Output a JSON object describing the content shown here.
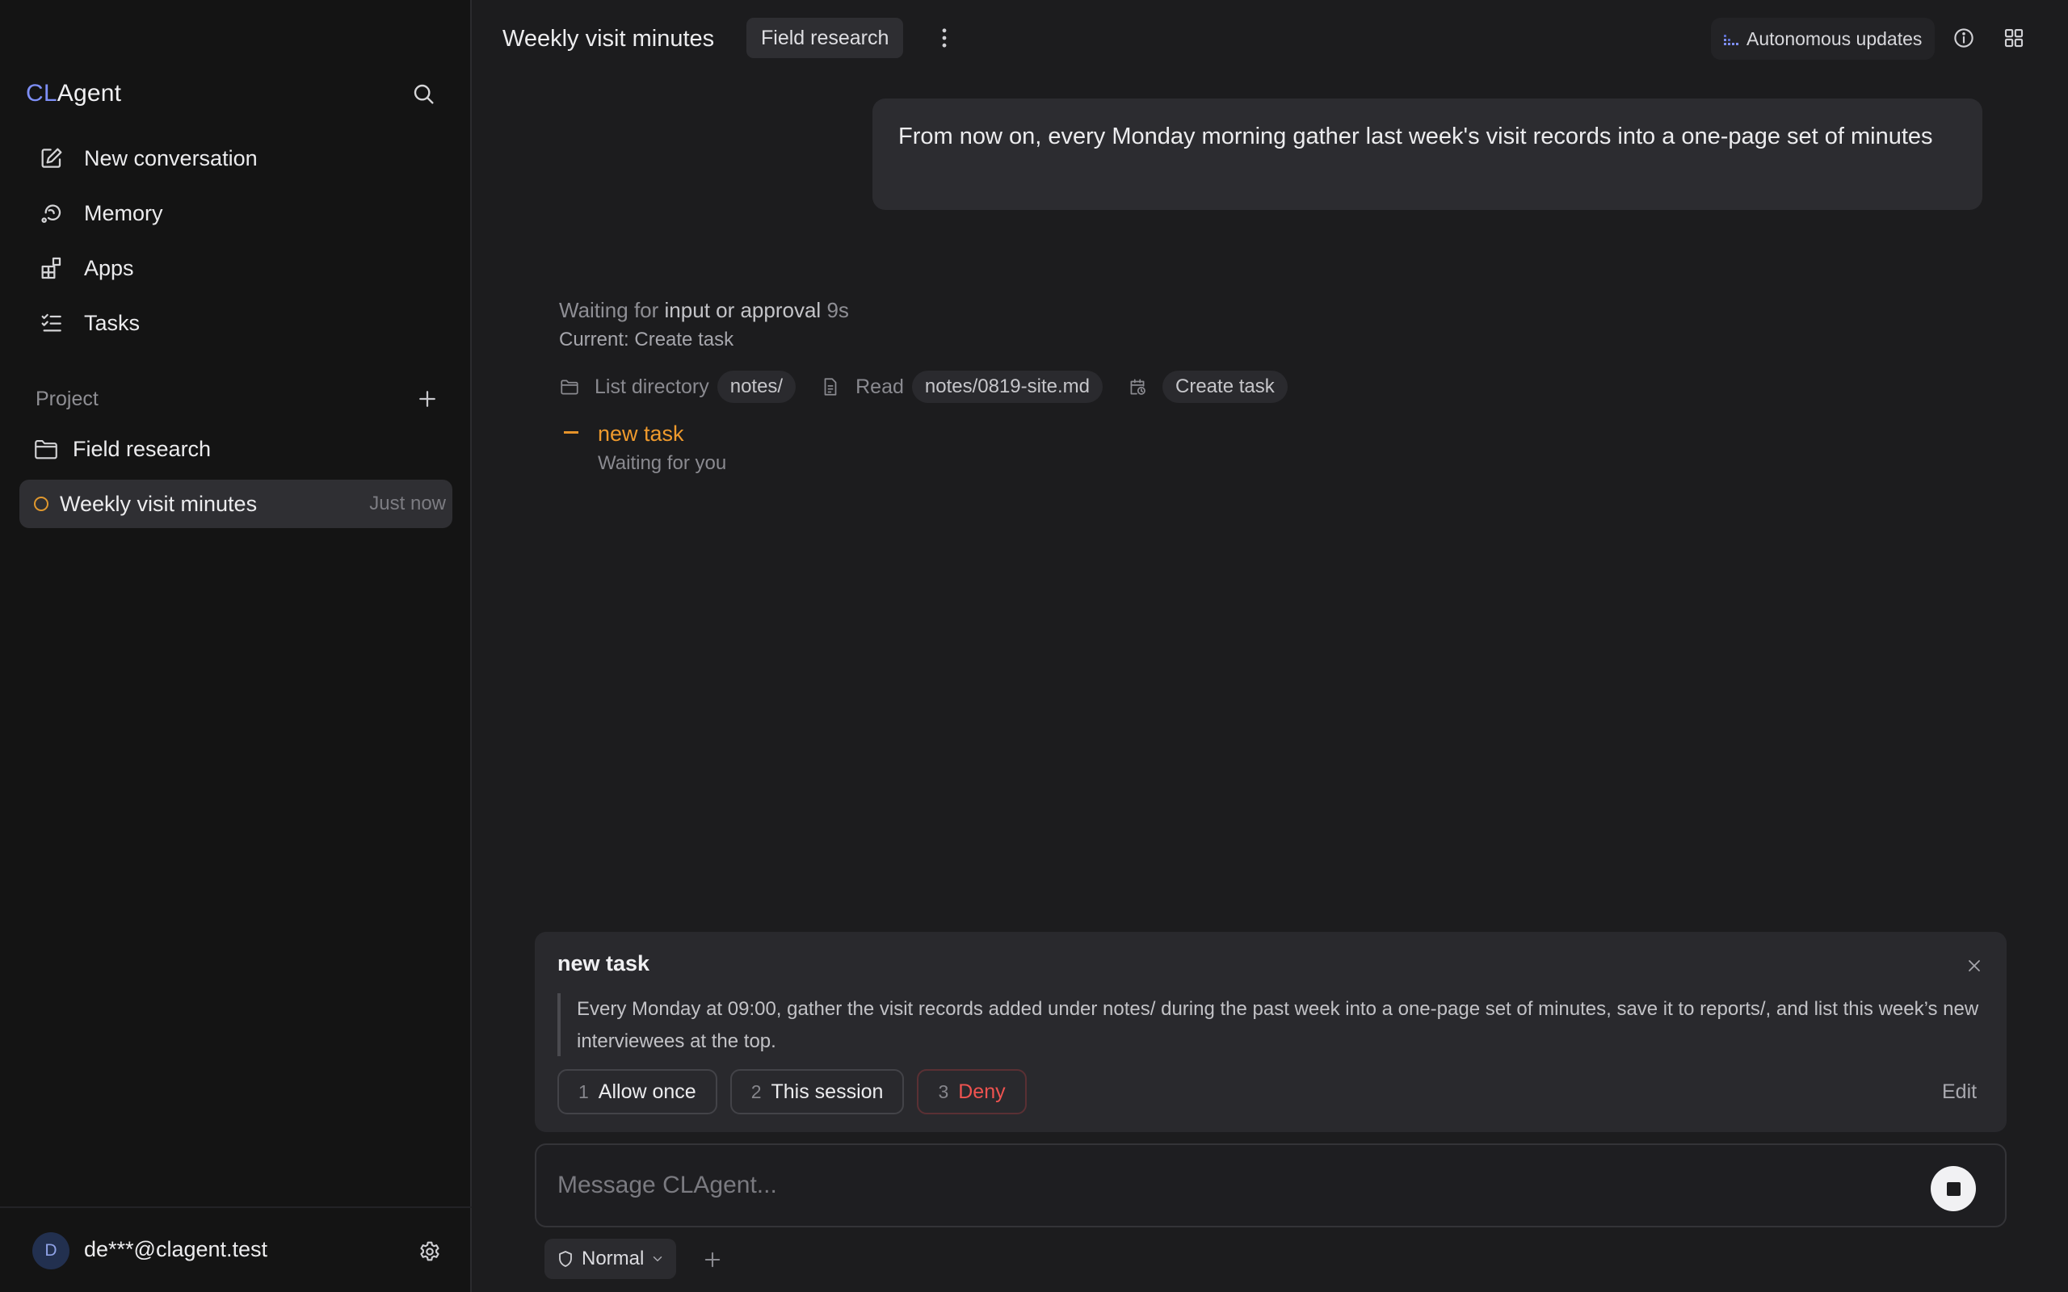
{
  "sidebar": {
    "brand_prefix": "CL",
    "brand_suffix": "Agent",
    "search_icon": "search-icon",
    "nav": [
      {
        "label": "New conversation",
        "icon": "new-conversation-icon"
      },
      {
        "label": "Memory",
        "icon": "memory-icon"
      },
      {
        "label": "Apps",
        "icon": "apps-icon"
      },
      {
        "label": "Tasks",
        "icon": "tasks-icon"
      }
    ],
    "project_header": "Project",
    "project_folder": "Field research",
    "conversation": {
      "title": "Weekly visit minutes",
      "time": "Just now",
      "status_color": "#e0982e"
    },
    "user": {
      "avatar_letter": "D",
      "email": "de***@clagent.test"
    }
  },
  "header": {
    "title": "Weekly visit minutes",
    "project_chip": "Field research",
    "autonomous_label": "Autonomous updates"
  },
  "conversation": {
    "user_message": "From now on, every Monday morning gather last week's visit records into a one-page set of minutes",
    "status": {
      "prefix": "Waiting for ",
      "emphasis": "input or approval",
      "elapsed": "9s",
      "current": "Current: Create task"
    },
    "steps": [
      {
        "label": "List directory",
        "chip": "notes/",
        "icon": "folder-icon"
      },
      {
        "label": "Read",
        "chip": "notes/0819-site.md",
        "icon": "file-icon"
      },
      {
        "label": "",
        "chip": "Create task",
        "icon": "calendar-clock-icon"
      }
    ],
    "task": {
      "title": "new task",
      "subtitle": "Waiting for you",
      "accent": "#ef9a2d"
    }
  },
  "approval": {
    "title": "new task",
    "description": "Every Monday at 09:00, gather the visit records added under notes/ during the past week into a one-page set of minutes, save it to reports/, and list this week’s new interviewees at the top.",
    "actions": [
      {
        "num": "1",
        "label": "Allow once"
      },
      {
        "num": "2",
        "label": "This session"
      },
      {
        "num": "3",
        "label": "Deny"
      }
    ],
    "edit_label": "Edit",
    "deny_color": "#ef5350"
  },
  "composer": {
    "placeholder": "Message CLAgent...",
    "value": "",
    "mode": "Normal"
  },
  "colors": {
    "accent": "#7e8ff7",
    "background": "#1c1c1e",
    "sidebar": "#141414"
  }
}
